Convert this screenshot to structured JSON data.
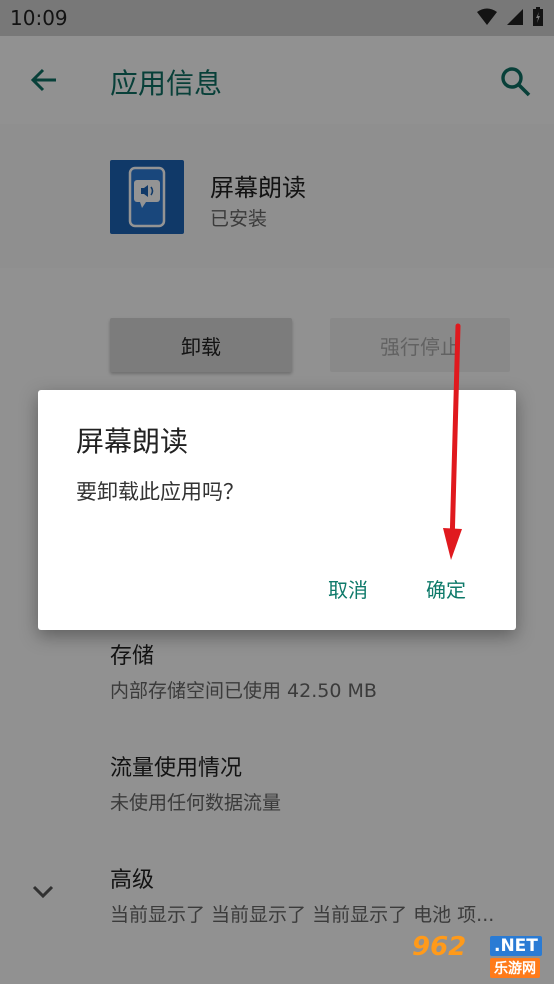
{
  "status_bar": {
    "time": "10:09",
    "icons": [
      "wifi-icon",
      "signal-icon",
      "battery-icon"
    ]
  },
  "app_bar": {
    "title": "应用信息",
    "back_icon": "arrow-back-icon",
    "search_icon": "search-icon"
  },
  "app": {
    "name": "屏幕朗读",
    "status": "已安装"
  },
  "actions": {
    "uninstall": "卸载",
    "force_stop": "强行停止"
  },
  "items": [
    {
      "title": "存储",
      "subtitle": "内部存储空间已使用 42.50 MB"
    },
    {
      "title": "流量使用情况",
      "subtitle": "未使用任何数据流量"
    },
    {
      "title": "高级",
      "subtitle": "当前显示了 当前显示了 当前显示了 电池 项..."
    }
  ],
  "dialog": {
    "title": "屏幕朗读",
    "message": "要卸载此应用吗？",
    "cancel": "取消",
    "ok": "确定"
  },
  "watermark": {
    "logo": "962",
    "net": ".NET",
    "sub": "乐游网"
  },
  "colors": {
    "accent": "#0e6e63",
    "dialog_button": "#0e7a6a",
    "arrow": "#e0191e",
    "app_icon": "#1c62b4"
  }
}
